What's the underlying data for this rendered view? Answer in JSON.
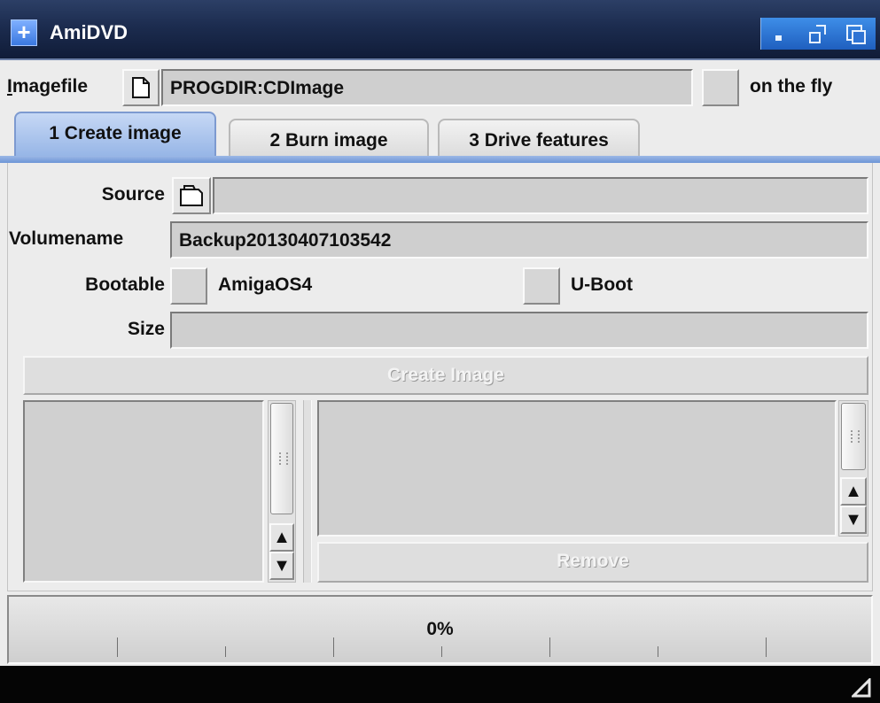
{
  "window": {
    "title": "AmiDVD",
    "plus_glyph": "+"
  },
  "imagefile": {
    "label": "Imagefile",
    "value": "PROGDIR:CDImage",
    "onthefly_label": "on the fly"
  },
  "tabs": [
    {
      "label": "1 Create image",
      "active": true
    },
    {
      "label": "2 Burn image",
      "active": false
    },
    {
      "label": "3 Drive features",
      "active": false
    }
  ],
  "create": {
    "source_label": "Source",
    "source_value": "",
    "volumename_label": "Volumename",
    "volumename_value": "Backup20130407103542",
    "bootable_label": "Bootable",
    "amigaos4_label": "AmigaOS4",
    "uboot_label": "U-Boot",
    "size_label": "Size",
    "size_value": "",
    "create_button": "Create Image",
    "remove_button": "Remove"
  },
  "progress": {
    "value": 0,
    "text": "0%"
  },
  "icons": {
    "file": "file-icon",
    "drawer": "drawer-icon",
    "up_arrow": "▲",
    "down_arrow": "▼"
  },
  "colors": {
    "titlebar": "#1c2c4f",
    "accent": "#6d95d6",
    "field_bg": "#cfcfcf"
  }
}
